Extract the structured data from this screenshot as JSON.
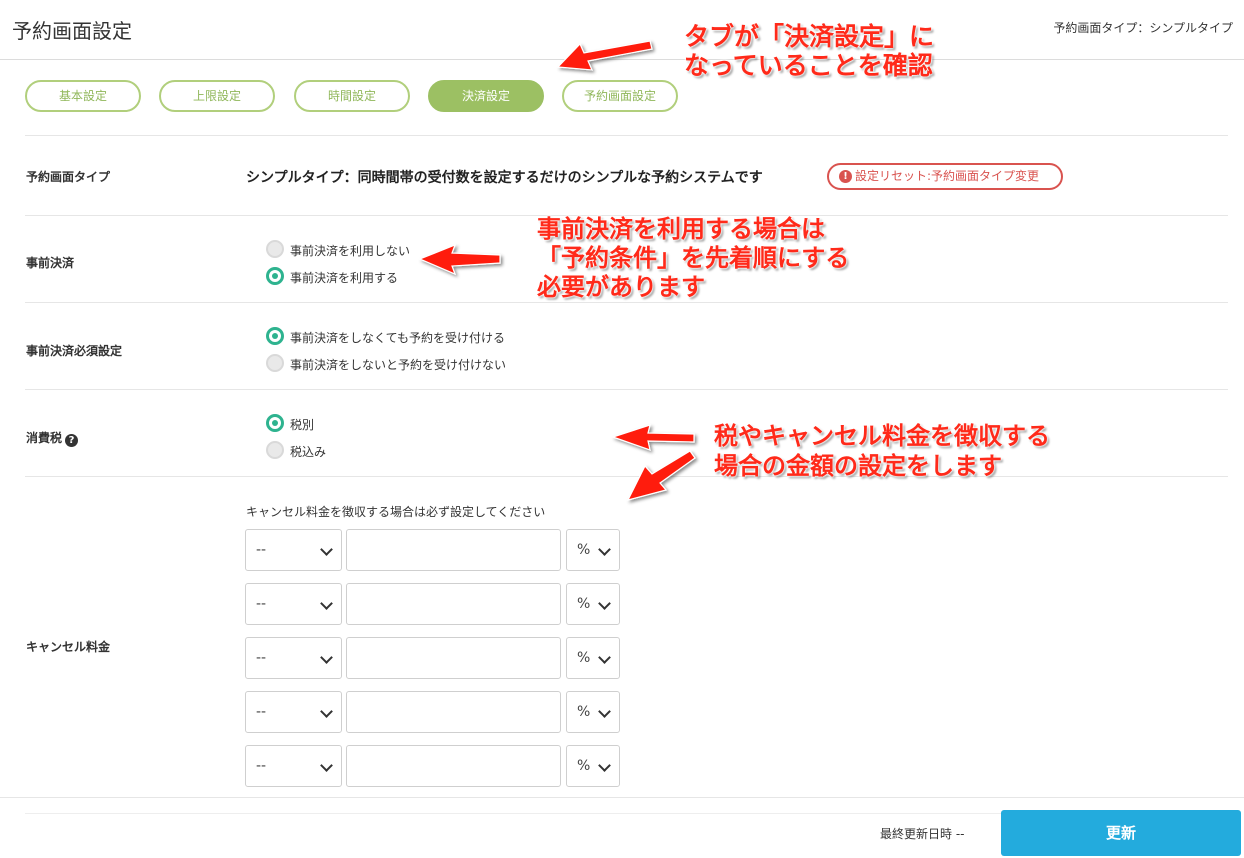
{
  "header": {
    "title": "予約画面設定",
    "type_label": "予約画面タイプ：シンプルタイプ"
  },
  "tabs": [
    {
      "label": "基本設定",
      "active": false
    },
    {
      "label": "上限設定",
      "active": false
    },
    {
      "label": "時間設定",
      "active": false
    },
    {
      "label": "決済設定",
      "active": true
    },
    {
      "label": "予約画面設定",
      "active": false
    }
  ],
  "reservation_type": {
    "label": "予約画面タイプ",
    "description": "シンプルタイプ：同時間帯の受付数を設定するだけのシンプルな予約システムです",
    "reset_button": "設定リセット:予約画面タイプ変更"
  },
  "prepayment": {
    "label": "事前決済",
    "options": [
      {
        "label": "事前決済を利用しない",
        "selected": false
      },
      {
        "label": "事前決済を利用する",
        "selected": true
      }
    ]
  },
  "prepayment_required": {
    "label": "事前決済必須設定",
    "options": [
      {
        "label": "事前決済をしなくても予約を受け付ける",
        "selected": true
      },
      {
        "label": "事前決済をしないと予約を受け付けない",
        "selected": false
      }
    ]
  },
  "tax": {
    "label": "消費税",
    "help_icon": "question-circle-icon",
    "options": [
      {
        "label": "税別",
        "selected": true
      },
      {
        "label": "税込み",
        "selected": false
      }
    ]
  },
  "cancel_fee": {
    "label": "キャンセル料金",
    "note": "キャンセル料金を徴収する場合は必ず設定してください",
    "rows": [
      {
        "timing": "--",
        "amount": "",
        "unit": "%"
      },
      {
        "timing": "--",
        "amount": "",
        "unit": "%"
      },
      {
        "timing": "--",
        "amount": "",
        "unit": "%"
      },
      {
        "timing": "--",
        "amount": "",
        "unit": "%"
      },
      {
        "timing": "--",
        "amount": "",
        "unit": "%"
      }
    ]
  },
  "footer": {
    "last_updated": "最終更新日時 --",
    "update_button": "更新"
  },
  "annotations": {
    "tab_note_line1": "タブが「決済設定」に",
    "tab_note_line2": "なっていることを確認",
    "prepay_note_line1": "事前決済を利用する場合は",
    "prepay_note_line2": "「予約条件」を先着順にする",
    "prepay_note_line3": "必要があります",
    "tax_note_line1": "税やキャンセル料金を徴収する",
    "tax_note_line2": "場合の金額の設定をします"
  },
  "colors": {
    "tab_border": "#b1cf7c",
    "tab_active": "#9cc063",
    "radio_on": "#2eb38f",
    "reset_red": "#d9534f",
    "update_blue": "#23abdd",
    "annotation_red": "#ff2a1a"
  }
}
